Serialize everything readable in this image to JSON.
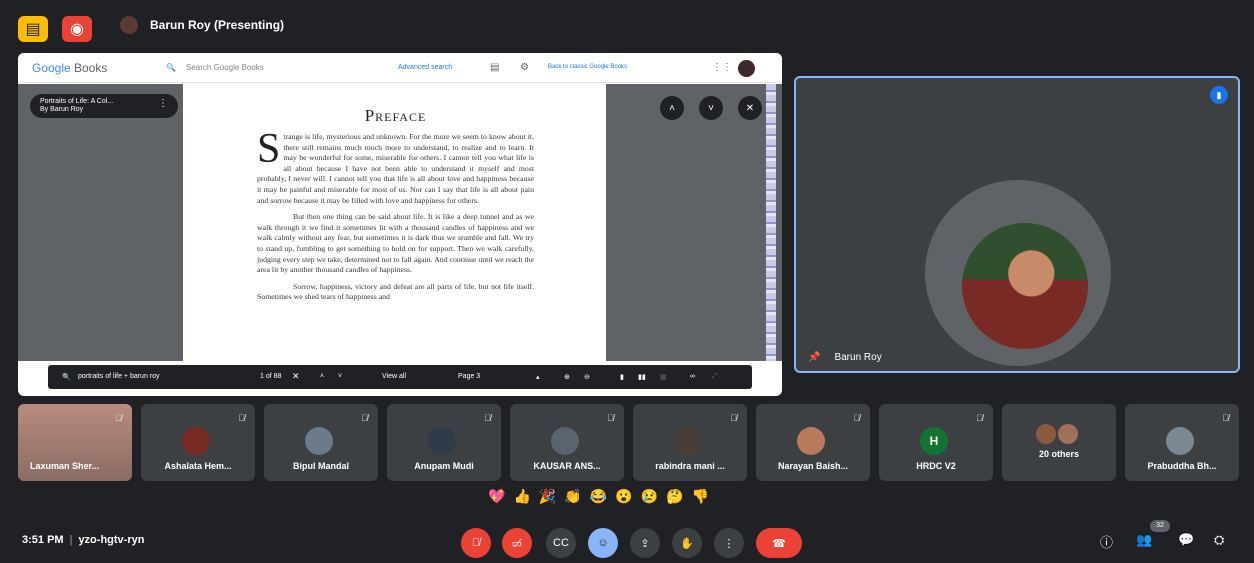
{
  "topbar": {
    "presenter": "Barun Roy (Presenting)",
    "accent": "#fbbc04"
  },
  "books": {
    "logo_google": "Google",
    "logo_books": "Books",
    "search_placeholder": "Search Google Books",
    "advanced": "Advanced search",
    "back_classic": "Back to classic Google Books",
    "chip_title": "Portraits of Life: A Col...",
    "chip_author": "By Barun Roy",
    "page_title": "Preface",
    "dropcap": "S",
    "para1": "trange is life, mysterious and unknown. For the more we seem to know about it, there still remains much much more to understand, to realize and to learn. It may be wonderful for some, miserable for others. I cannot tell you what life is all about because I have not been able to understand it myself and most probably, I never will. I cannot tell you that life is all about love and happiness because it may be painful and miserable for most of us. Nor can I say that life is all about pain and sorrow because it may be filled with love and happiness for others.",
    "para2": "But then one thing can be said about life. It is like a deep tunnel and as we walk through it we find it sometimes lit with a thousand candles of happiness and we walk calmly without any fear, but sometimes it is dark thus we stumble and fall. We try to stand up, fumbling to get something to hold on for support. Then we walk carefully, judging every step we take, determined not to fall again. And continue until we reach the area lit by another thousand candles of happiness.",
    "para3": "Sorrow, happiness, victory and defeat are all parts of life, but not life itself. Sometimes we shed tears of happiness and",
    "footer": {
      "query": "portraits of life + barun roy",
      "count": "1 of 88",
      "view_all": "View all",
      "page": "Page 3"
    }
  },
  "main_video": {
    "name": "Barun Roy"
  },
  "participants": [
    {
      "name": "Laxuman Sher...",
      "video": true
    },
    {
      "name": "Ashalata Hem..."
    },
    {
      "name": "Bipul Mandal"
    },
    {
      "name": "Anupam Mudi"
    },
    {
      "name": "KAUSAR ANS..."
    },
    {
      "name": "rabindra mani ..."
    },
    {
      "name": "Narayan Baish..."
    },
    {
      "name": "HRDC V2",
      "initial": "H"
    },
    {
      "name": "20 others"
    },
    {
      "name": "Prabuddha Bh..."
    }
  ],
  "reactions": [
    "💖",
    "👍",
    "🎉",
    "👏",
    "😂",
    "😮",
    "😢",
    "🤔",
    "👎"
  ],
  "bottom": {
    "time": "3:51 PM",
    "meeting_code": "yzo-hgtv-ryn",
    "people_count": "32"
  }
}
